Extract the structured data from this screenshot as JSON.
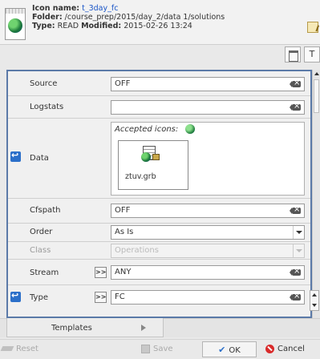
{
  "header": {
    "icon_name_label": "Icon name:",
    "icon_name_value": "t_3day_fc",
    "folder_label": "Folder:",
    "folder_value": "/course_prep/2015/day_2/data 1/solutions",
    "type_label": "Type:",
    "type_value": "READ",
    "modified_label": "Modified:",
    "modified_value": "2015-02-26 13:24"
  },
  "toolbar": {
    "text_button_label": "T"
  },
  "params": {
    "source": {
      "label": "Source",
      "value": "OFF"
    },
    "logstats": {
      "label": "Logstats",
      "value": ""
    },
    "data": {
      "label": "Data",
      "accepted_label": "Accepted icons:",
      "file_name": "ztuv.grb"
    },
    "cfspath": {
      "label": "Cfspath",
      "value": "OFF"
    },
    "order": {
      "label": "Order",
      "value": "As Is"
    },
    "class": {
      "label": "Class",
      "value": "Operations"
    },
    "stream": {
      "label": "Stream",
      "value": "ANY",
      "button": ">>"
    },
    "type": {
      "label": "Type",
      "value": "FC",
      "button": ">>"
    }
  },
  "tabs": {
    "templates": "Templates"
  },
  "buttons": {
    "reset": "Reset",
    "save": "Save",
    "ok": "OK",
    "cancel": "Cancel"
  },
  "icons": {
    "header_icon": "globe-grib-icon",
    "edit_icon": "pencil-notepad-icon",
    "accepted_icon": "globe-icon",
    "file_icon": "grib-file-icon"
  },
  "colors": {
    "frame_border": "#5b7aa8",
    "link_blue": "#1a55c8",
    "marker_blue": "#2b6fc9",
    "cancel_red": "#d92a2a"
  }
}
